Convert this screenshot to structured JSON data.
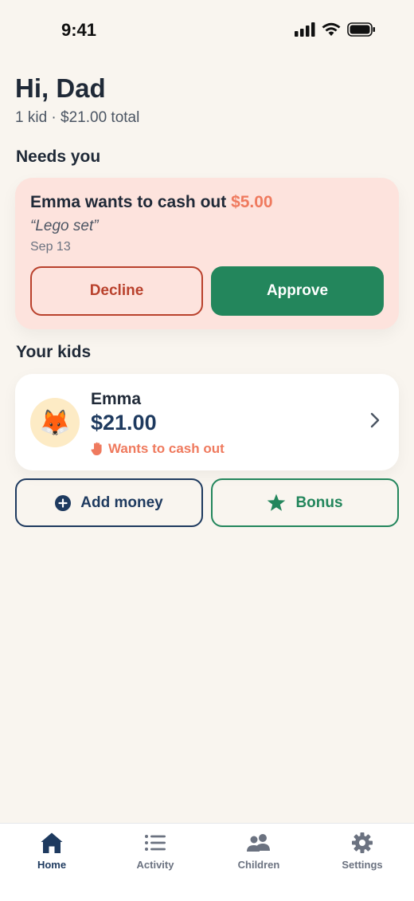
{
  "status_bar": {
    "time": "9:41"
  },
  "header": {
    "greeting": "Hi, Dad",
    "summary": "1 kid · $21.00 total"
  },
  "needs_you": {
    "title": "Needs you",
    "request": {
      "text": "Emma wants to cash out",
      "amount": "$5.00",
      "note": "“Lego set”",
      "date": "Sep 13",
      "decline_label": "Decline",
      "approve_label": "Approve"
    }
  },
  "kids": {
    "title": "Your kids",
    "items": [
      {
        "avatar_emoji": "🦊",
        "name": "Emma",
        "balance": "$21.00",
        "status": "Wants to cash out"
      }
    ]
  },
  "actions": {
    "add_money_label": "Add money",
    "bonus_label": "Bonus"
  },
  "tab_bar": {
    "tabs": [
      {
        "label": "Home",
        "icon": "home-icon",
        "active": true
      },
      {
        "label": "Activity",
        "icon": "list-icon",
        "active": false
      },
      {
        "label": "Children",
        "icon": "people-icon",
        "active": false
      },
      {
        "label": "Settings",
        "icon": "gear-icon",
        "active": false
      }
    ]
  },
  "colors": {
    "background": "#F9F5EF",
    "accent_green": "#23865C",
    "accent_navy": "#1E3A5F",
    "accent_coral": "#EF7A5E",
    "decline_red": "#B9412C",
    "request_bg": "#FDE3DD"
  }
}
